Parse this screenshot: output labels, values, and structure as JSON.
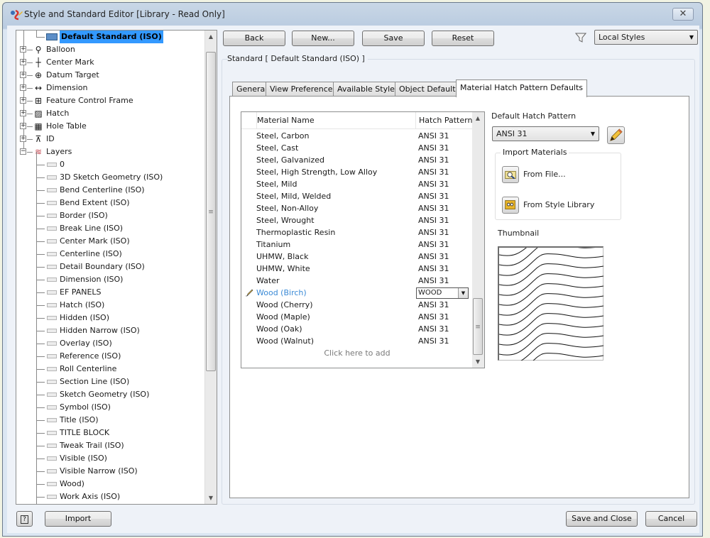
{
  "window": {
    "title": "Style and Standard Editor [Library - Read Only]",
    "close_label": "✕"
  },
  "tree": {
    "selected": "Default Standard (ISO)",
    "categories": [
      {
        "label": "Balloon",
        "icon": "balloon-icon",
        "expanded": false
      },
      {
        "label": "Center Mark",
        "icon": "center-mark-icon",
        "expanded": false
      },
      {
        "label": "Datum Target",
        "icon": "datum-target-icon",
        "expanded": false
      },
      {
        "label": "Dimension",
        "icon": "dimension-icon",
        "expanded": false
      },
      {
        "label": "Feature Control Frame",
        "icon": "feature-control-frame-icon",
        "expanded": false
      },
      {
        "label": "Hatch",
        "icon": "hatch-icon",
        "expanded": false
      },
      {
        "label": "Hole Table",
        "icon": "hole-table-icon",
        "expanded": false
      },
      {
        "label": "ID",
        "icon": "id-icon",
        "expanded": false
      },
      {
        "label": "Layers",
        "icon": "layers-icon",
        "expanded": true
      }
    ],
    "layers": [
      "0",
      "3D Sketch Geometry (ISO)",
      "Bend Centerline (ISO)",
      "Bend Extent (ISO)",
      "Border (ISO)",
      "Break Line (ISO)",
      "Center Mark (ISO)",
      "Centerline (ISO)",
      "Detail Boundary (ISO)",
      "Dimension (ISO)",
      "EF PANELS",
      "Hatch (ISO)",
      "Hidden (ISO)",
      "Hidden Narrow (ISO)",
      "Overlay (ISO)",
      "Reference (ISO)",
      "Roll Centerline",
      "Section Line (ISO)",
      "Sketch Geometry (ISO)",
      "Symbol (ISO)",
      "Title (ISO)",
      "TITLE BLOCK",
      "Tweak Trail (ISO)",
      "Visible (ISO)",
      "Visible Narrow (ISO)",
      "Wood)",
      "Work Axis (ISO)"
    ]
  },
  "toolbar": {
    "back": "Back",
    "new": "New...",
    "save": "Save",
    "reset": "Reset",
    "filter_value": "Local Styles"
  },
  "standard_label": "Standard [ Default Standard (ISO) ]",
  "tabs": [
    {
      "label": "General",
      "active": false
    },
    {
      "label": "View Preferences",
      "active": false
    },
    {
      "label": "Available Styles",
      "active": false
    },
    {
      "label": "Object Defaults",
      "active": false
    },
    {
      "label": "Material Hatch Pattern Defaults",
      "active": true
    }
  ],
  "materials": {
    "columns": [
      "Material Name",
      "Hatch Pattern"
    ],
    "rows": [
      {
        "name": "Steel, Carbon",
        "hatch": "ANSI 31"
      },
      {
        "name": "Steel, Cast",
        "hatch": "ANSI 31"
      },
      {
        "name": "Steel, Galvanized",
        "hatch": "ANSI 31"
      },
      {
        "name": "Steel, High Strength, Low Alloy",
        "hatch": "ANSI 31"
      },
      {
        "name": "Steel, Mild",
        "hatch": "ANSI 31"
      },
      {
        "name": "Steel, Mild, Welded",
        "hatch": "ANSI 31"
      },
      {
        "name": "Steel, Non-Alloy",
        "hatch": "ANSI 31"
      },
      {
        "name": "Steel, Wrought",
        "hatch": "ANSI 31"
      },
      {
        "name": "Thermoplastic Resin",
        "hatch": "ANSI 31"
      },
      {
        "name": "Titanium",
        "hatch": "ANSI 31"
      },
      {
        "name": "UHMW, Black",
        "hatch": "ANSI 31"
      },
      {
        "name": "UHMW, White",
        "hatch": "ANSI 31"
      },
      {
        "name": "Water",
        "hatch": "ANSI 31"
      },
      {
        "name": "Wood (Birch)",
        "hatch": "WOOD",
        "editing": true
      },
      {
        "name": "Wood (Cherry)",
        "hatch": "ANSI 31"
      },
      {
        "name": "Wood (Maple)",
        "hatch": "ANSI 31"
      },
      {
        "name": "Wood (Oak)",
        "hatch": "ANSI 31"
      },
      {
        "name": "Wood (Walnut)",
        "hatch": "ANSI 31"
      }
    ],
    "add_row": "Click here to add"
  },
  "default_hatch": {
    "label": "Default Hatch Pattern",
    "value": "ANSI 31"
  },
  "import_materials": {
    "label": "Import Materials",
    "from_file": "From File...",
    "from_library": "From Style Library"
  },
  "thumbnail_label": "Thumbnail",
  "footer": {
    "help": "?",
    "import": "Import",
    "save_close": "Save and Close",
    "cancel": "Cancel"
  },
  "colors": {
    "selection": "#3399ff",
    "editing_text": "#3a8ad6"
  }
}
